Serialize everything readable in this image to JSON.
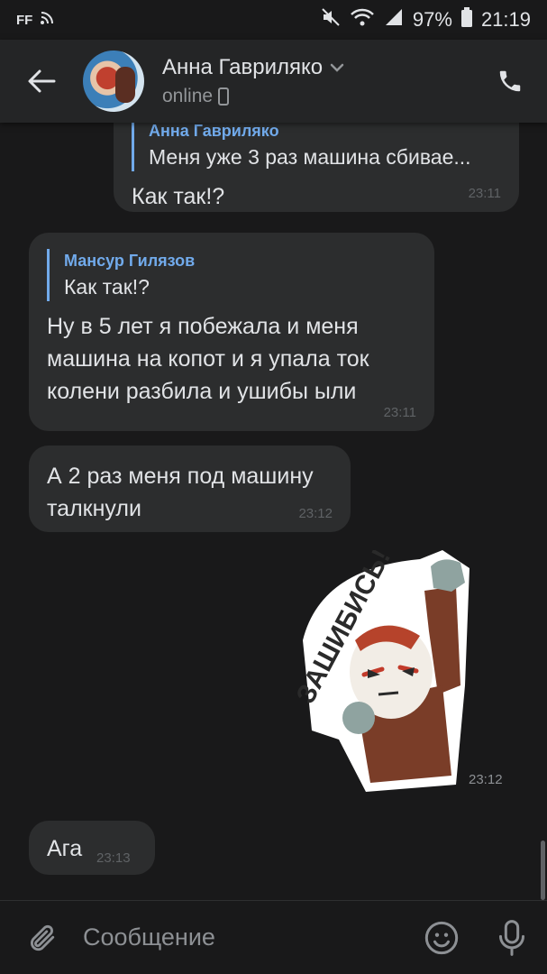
{
  "status_bar": {
    "left_label": "FF",
    "battery_percent": "97%",
    "time": "21:19"
  },
  "header": {
    "contact_name": "Анна Гавриляко",
    "status": "online"
  },
  "messages": [
    {
      "direction": "outgoing",
      "reply_to_name": "Анна Гавриляко",
      "reply_to_text": "Меня уже 3 раз машина сбивае...",
      "text": "Как так!?",
      "time": "23:11"
    },
    {
      "direction": "incoming",
      "reply_to_name": "Мансур Гилязов",
      "reply_to_text": "Как так!?",
      "text_lines": [
        "Ну в 5 лет я побежала и меня",
        "машина на копот и я упала ток",
        "колени разбила и ушибы ыли"
      ],
      "time": "23:11"
    },
    {
      "direction": "incoming",
      "text_lines": [
        "А 2 раз меня под машину",
        "талкнули"
      ],
      "time": "23:12"
    },
    {
      "direction": "outgoing",
      "type": "sticker",
      "sticker_text": "ЗАШИБИСЬ!",
      "time": "23:12"
    },
    {
      "direction": "incoming",
      "text": "Ага",
      "time": "23:13"
    }
  ],
  "composer": {
    "placeholder": "Сообщение"
  },
  "colors": {
    "background": "#19191a",
    "header": "#242526",
    "bubble": "#2c2d2e",
    "accent": "#71aaeb",
    "text": "#e1e3e6",
    "secondary": "#939699"
  },
  "icons": [
    "back-arrow-icon",
    "phone-icon",
    "chevron-down-icon",
    "mobile-device-icon",
    "paperclip-icon",
    "emoji-icon",
    "microphone-icon",
    "mute-icon",
    "wifi-icon",
    "signal-icon",
    "battery-icon",
    "rss-icon"
  ]
}
